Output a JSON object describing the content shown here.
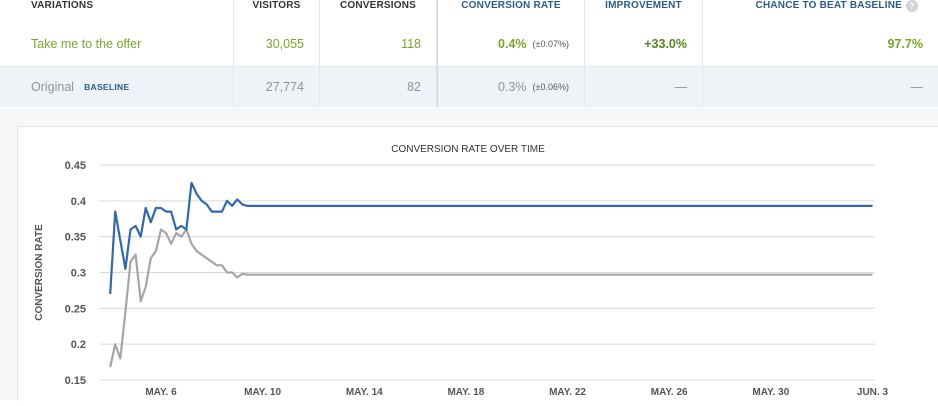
{
  "table": {
    "headers": {
      "variations": "VARIATIONS",
      "visitors": "VISITORS",
      "conversions": "CONVERSIONS",
      "conversion_rate": "CONVERSION RATE",
      "improvement": "IMPROVEMENT",
      "chance_to_beat": "CHANCE TO BEAT BASELINE",
      "help_icon": "?"
    },
    "rows": [
      {
        "name": "Take me to the offer",
        "visitors": "30,055",
        "conversions": "118",
        "conversion_rate": "0.4%",
        "conversion_rate_ci": "(±0.07%)",
        "improvement": "+33.0%",
        "chance_to_beat": "97.7%"
      },
      {
        "name": "Original",
        "badge": "BASELINE",
        "visitors": "27,774",
        "conversions": "82",
        "conversion_rate": "0.3%",
        "conversion_rate_ci": "(±0.06%)",
        "improvement": "—",
        "chance_to_beat": "—"
      }
    ]
  },
  "colors": {
    "variation_line": "#2f6aae",
    "baseline_line": "#a6a6a6",
    "green": "#7aa42a",
    "header_blue": "#2a5b8f"
  },
  "chart_data": {
    "type": "line",
    "title": "CONVERSION RATE OVER TIME",
    "xlabel": "",
    "ylabel": "CONVERSION RATE",
    "ylim": [
      0.15,
      0.45
    ],
    "yticks": [
      "0.15",
      "0.2",
      "0.25",
      "0.3",
      "0.35",
      "0.4",
      "0.45"
    ],
    "xticks": [
      "MAY. 6",
      "MAY. 10",
      "MAY. 14",
      "MAY. 18",
      "MAY. 22",
      "MAY. 26",
      "MAY. 30",
      "JUN. 3"
    ],
    "xtick_days": [
      6,
      10,
      14,
      18,
      22,
      26,
      30,
      34
    ],
    "grid": true,
    "series": [
      {
        "key": "variation",
        "color": "#2f6aae",
        "x": [
          4.0,
          4.2,
          4.4,
          4.6,
          4.8,
          5.0,
          5.2,
          5.4,
          5.6,
          5.8,
          6.0,
          6.2,
          6.4,
          6.6,
          6.8,
          7.0,
          7.2,
          7.4,
          7.6,
          7.8,
          8.0,
          8.2,
          8.4,
          8.6,
          8.8,
          9.0,
          9.2,
          9.4,
          34.0
        ],
        "y": [
          0.27,
          0.385,
          0.345,
          0.305,
          0.36,
          0.365,
          0.35,
          0.39,
          0.37,
          0.39,
          0.39,
          0.385,
          0.385,
          0.36,
          0.365,
          0.36,
          0.425,
          0.41,
          0.4,
          0.395,
          0.385,
          0.385,
          0.385,
          0.4,
          0.393,
          0.402,
          0.395,
          0.393,
          0.393
        ]
      },
      {
        "key": "baseline",
        "color": "#a6a6a6",
        "x": [
          4.0,
          4.2,
          4.4,
          4.6,
          4.8,
          5.0,
          5.2,
          5.4,
          5.6,
          5.8,
          6.0,
          6.2,
          6.4,
          6.6,
          6.8,
          7.0,
          7.2,
          7.4,
          7.6,
          7.8,
          8.0,
          8.2,
          8.4,
          8.6,
          8.8,
          9.0,
          9.2,
          9.4,
          34.0
        ],
        "y": [
          0.168,
          0.2,
          0.18,
          0.245,
          0.315,
          0.325,
          0.26,
          0.28,
          0.32,
          0.33,
          0.36,
          0.355,
          0.34,
          0.355,
          0.35,
          0.36,
          0.34,
          0.33,
          0.325,
          0.32,
          0.315,
          0.31,
          0.31,
          0.3,
          0.3,
          0.293,
          0.298,
          0.297,
          0.297
        ]
      }
    ]
  }
}
